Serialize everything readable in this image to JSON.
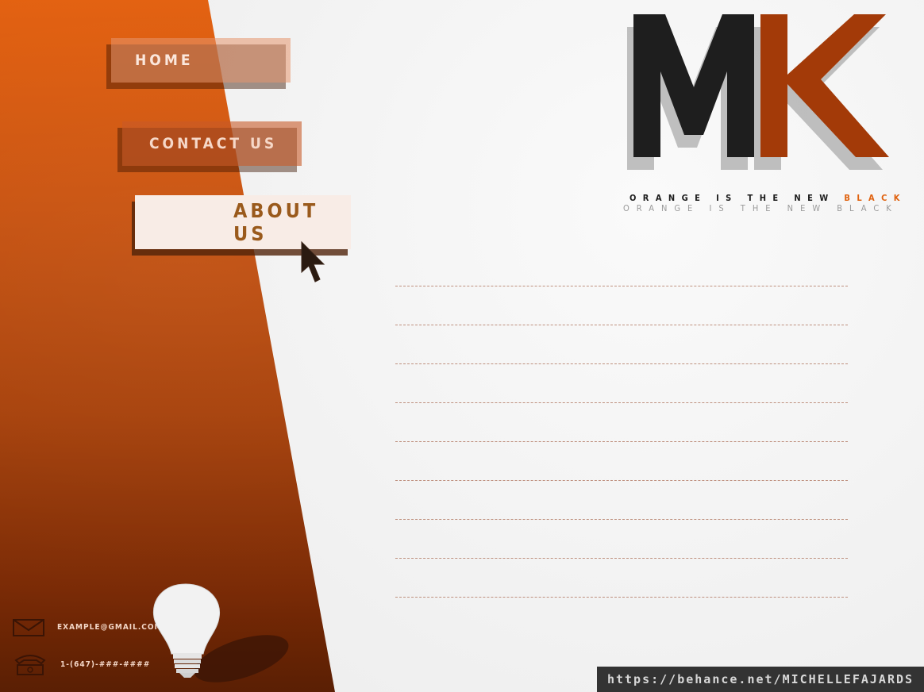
{
  "nav": {
    "home": "HOME",
    "contact": "CONTACT US",
    "about": "ABOUT US"
  },
  "logo": {
    "letters": "MK",
    "tagline_part1": "ORANGE IS THE NEW",
    "tagline_accent": "BLACK",
    "tagline_echo": "ORANGE IS THE NEW BLACK"
  },
  "contact": {
    "email": "EXAMPLE@GMAIL.COM",
    "phone": "1-(647)-###-####"
  },
  "footer": {
    "url": "https://behance.net/MICHELLEFAJARDS"
  },
  "colors": {
    "orange": "#e3600f",
    "dark_orange": "#a33a08",
    "logo_black": "#1e1e1e",
    "accent": "#e0620f"
  },
  "icons": [
    "mail-icon",
    "phone-icon",
    "cursor-icon",
    "lightbulb-icon",
    "logo-mark"
  ]
}
